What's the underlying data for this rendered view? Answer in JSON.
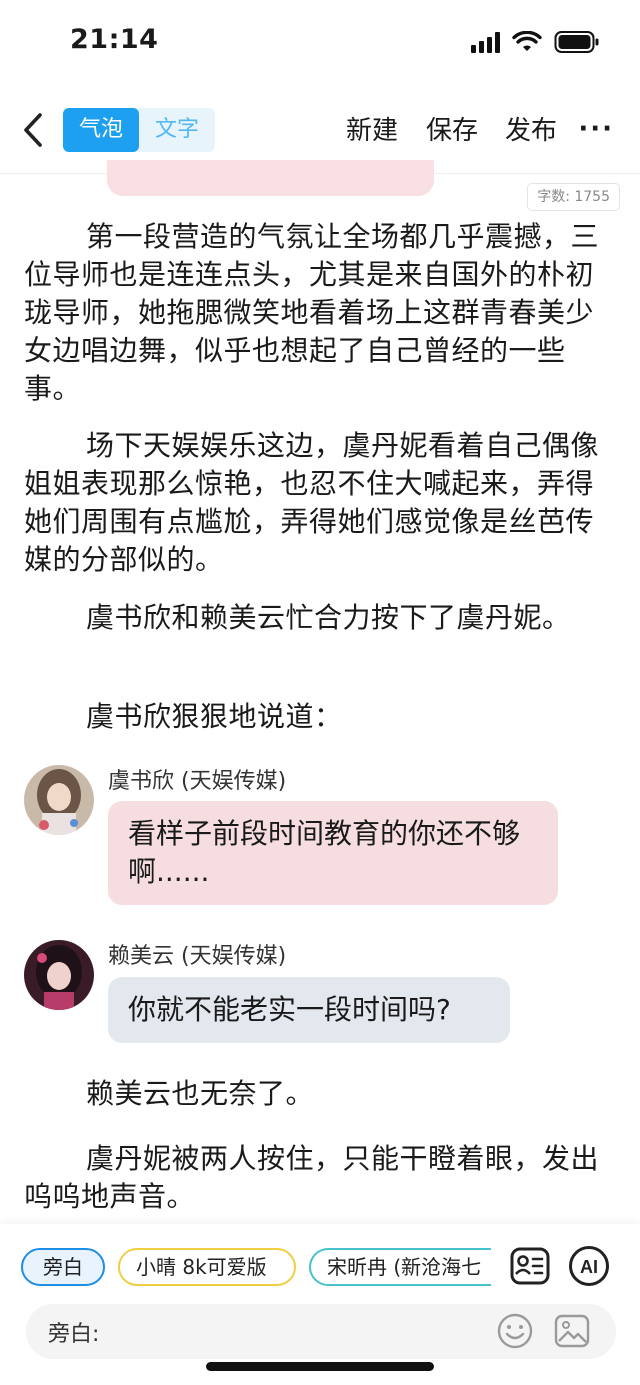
{
  "status_bar": {
    "time": "21:14"
  },
  "nav": {
    "mode_tabs": [
      "气泡",
      "文字"
    ],
    "actions": {
      "new": "新建",
      "save": "保存",
      "publish": "发布"
    },
    "more": "···"
  },
  "word_count": "字数: 1755",
  "paragraphs": [
    "第一段营造的气氛让全场都几乎震撼，三位导师也是连连点头，尤其是来自国外的朴初珑导师，她拖腮微笑地看着场上这群青春美少女边唱边舞，似乎也想起了自己曾经的一些事。",
    "场下天娱娱乐这边，虞丹妮看着自己偶像姐姐表现那么惊艳，也忍不住大喊起来，弄得她们周围有点尴尬，弄得她们感觉像是丝芭传媒的分部似的。",
    "虞书欣和赖美云忙合力按下了虞丹妮。",
    "虞书欣狠狠地说道："
  ],
  "messages": [
    {
      "speaker": "虞书欣 (天娱传媒)",
      "text": "看样子前段时间教育的你还不够啊......"
    },
    {
      "speaker": "赖美云 (天娱传媒)",
      "text": "你就不能老实一段时间吗?"
    }
  ],
  "paragraphs_after": [
    "赖美云也无奈了。",
    "虞丹妮被两人按住，只能干瞪着眼，发出呜呜地声音。"
  ],
  "bottom": {
    "chips": [
      "旁白",
      "小晴 8k可爱版",
      "宋昕冉 (新沧海七"
    ],
    "ai_label": "AI",
    "input_label": "旁白:"
  },
  "icons": {
    "back": "chevron-left-icon",
    "contact_card": "contact-card-icon",
    "ai": "ai-icon",
    "emoji": "emoji-icon",
    "image": "image-icon"
  },
  "colors": {
    "accent": "#1ea0f0",
    "pink_bubble": "#f5dde0",
    "gray_bubble": "#e3e8ee"
  }
}
